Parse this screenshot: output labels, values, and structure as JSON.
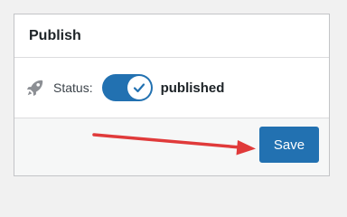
{
  "panel": {
    "title": "Publish"
  },
  "status": {
    "label": "Status:",
    "value": "published",
    "toggle_on": true,
    "icon": "rocket-icon"
  },
  "footer": {
    "save_label": "Save"
  },
  "annotation": {
    "arrow_color": "#e03a3a",
    "points_to": "save-button"
  },
  "colors": {
    "accent": "#2271b1",
    "page_background": "#f1f1f1",
    "panel_background": "#ffffff",
    "footer_background": "#f6f7f7"
  }
}
